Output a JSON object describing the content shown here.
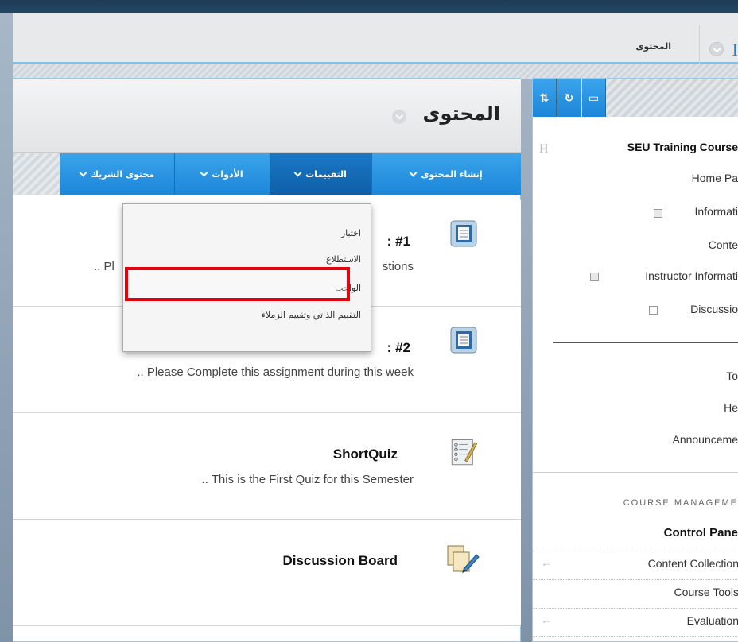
{
  "breadcrumb": {
    "current": "المحتوى",
    "home_glyph": "I"
  },
  "content": {
    "title": "المحتوى",
    "action_buttons": [
      {
        "label": "إنشاء المحتوى"
      },
      {
        "label": "التقييمات"
      },
      {
        "label": "الأدوات"
      },
      {
        "label": "محتوى الشريك"
      }
    ],
    "items": [
      {
        "title_fragment_right": "#1",
        "title_fragment_left": ":",
        "desc_right": "stions",
        "desc_left": ".. Pl"
      },
      {
        "title_fragment_right": "#2",
        "title_fragment_left": ":",
        "desc": ".. Please Complete this assignment during this week"
      },
      {
        "title": "ShortQuiz",
        "desc": ".. This is the First Quiz for this Semester"
      },
      {
        "title": "Discussion Board"
      }
    ]
  },
  "assessments_menu": {
    "items": [
      "اختبار",
      "الاستطلاع",
      "الواجب",
      "التقييم الذاتي وتقييم الزملاء"
    ],
    "highlighted": "الواجب"
  },
  "course_menu": {
    "toolbar": [
      "⇅",
      "↻",
      "▭"
    ],
    "h_glyph": "H",
    "course_title": "SEU Training Course",
    "links": [
      "Home Pa",
      "Informati",
      "Conte",
      "Instructor Informati",
      "Discussio"
    ],
    "tools": [
      "To",
      "He",
      "Announceme"
    ],
    "management_label": "COURSE MANAGEME",
    "control_panel": "Control Pane",
    "cp_rows": [
      "Content Collection",
      "Course Tools",
      "Evaluation"
    ],
    "arrow_glyph": "←"
  },
  "colors": {
    "button_blue": "#1c86d8",
    "highlight_red": "#e8000b",
    "top_bar": "#1e3b55"
  }
}
